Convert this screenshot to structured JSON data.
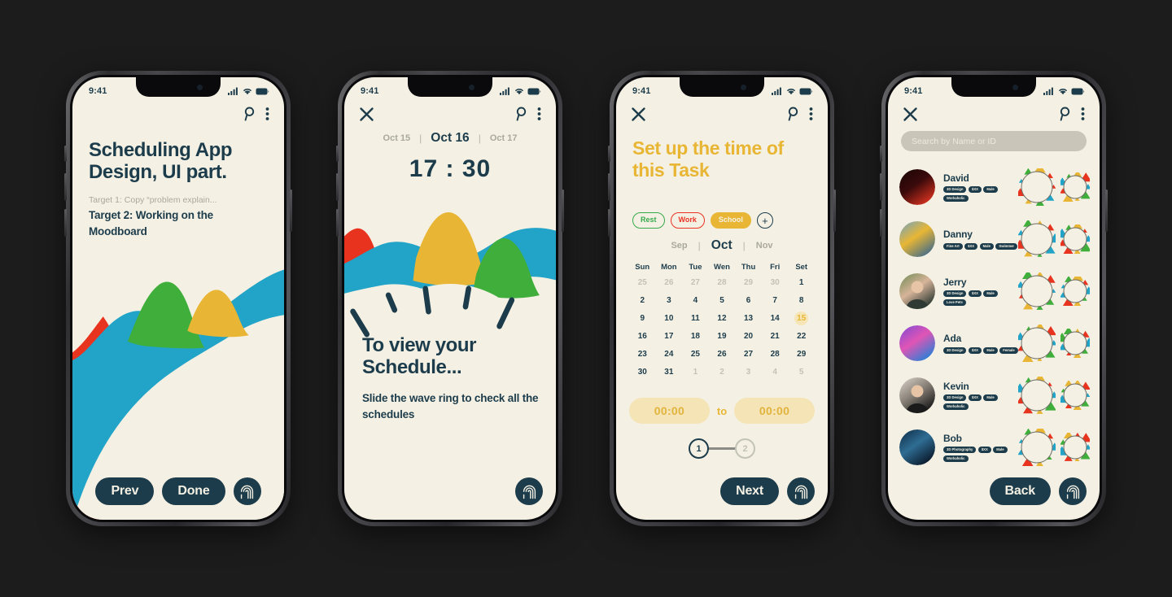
{
  "meta": {
    "background": "#1c1c1c",
    "screen_bg": "#f4f1e4",
    "ink": "#1d3c4b",
    "accent_yellow": "#e8b634",
    "accent_green": "#36a94b",
    "accent_red": "#ea3323",
    "accent_blue": "#22a3c8",
    "muted": "#a9a99c"
  },
  "status_bar": {
    "time": "9:41",
    "icons": [
      "cellular-signal-icon",
      "wifi-icon",
      "battery-icon"
    ]
  },
  "common": {
    "search_icon": "search-icon",
    "menu_icon": "more-vertical-icon",
    "close_icon": "close-icon",
    "fingerprint_icon": "fingerprint-icon"
  },
  "screen1": {
    "name": "intro-screen",
    "headline": "Scheduling App Design, UI part.",
    "target_done": "Target 1: Copy “problem explain...",
    "target_active": "Target 2: Working on the Moodboard",
    "buttons": {
      "prev": "Prev",
      "done": "Done"
    }
  },
  "screen2": {
    "name": "schedule-clock-screen",
    "dates": [
      {
        "label": "Oct 15",
        "active": false
      },
      {
        "label": "Oct 16",
        "active": true
      },
      {
        "label": "Oct 17",
        "active": false
      }
    ],
    "separator": "|",
    "clock": "17 : 30",
    "headline": "To view your Schedule...",
    "subtext": "Slide the wave ring to check all the schedules"
  },
  "screen3": {
    "name": "set-task-time-screen",
    "title": "Set up the time of this Task",
    "chips": [
      {
        "label": "Rest",
        "style": "rest"
      },
      {
        "label": "Work",
        "style": "work"
      },
      {
        "label": "School",
        "style": "school"
      }
    ],
    "chip_add": "+",
    "months": [
      {
        "label": "Sep",
        "active": false
      },
      {
        "label": "Oct",
        "active": true
      },
      {
        "label": "Nov",
        "active": false
      }
    ],
    "separator": "|",
    "day_headers": [
      "Sun",
      "Mon",
      "Tue",
      "Wen",
      "Thu",
      "Fri",
      "Set"
    ],
    "weeks": [
      [
        {
          "d": "25",
          "s": "out"
        },
        {
          "d": "26",
          "s": "out"
        },
        {
          "d": "27",
          "s": "out"
        },
        {
          "d": "28",
          "s": "out"
        },
        {
          "d": "29",
          "s": "out"
        },
        {
          "d": "30",
          "s": "out"
        },
        {
          "d": "1",
          "s": "in"
        }
      ],
      [
        {
          "d": "2",
          "s": "in"
        },
        {
          "d": "3",
          "s": "in"
        },
        {
          "d": "4",
          "s": "in"
        },
        {
          "d": "5",
          "s": "in"
        },
        {
          "d": "6",
          "s": "in"
        },
        {
          "d": "7",
          "s": "in"
        },
        {
          "d": "8",
          "s": "in"
        }
      ],
      [
        {
          "d": "9",
          "s": "in"
        },
        {
          "d": "10",
          "s": "in"
        },
        {
          "d": "11",
          "s": "in"
        },
        {
          "d": "12",
          "s": "in"
        },
        {
          "d": "13",
          "s": "in"
        },
        {
          "d": "14",
          "s": "in"
        },
        {
          "d": "15",
          "s": "sel"
        }
      ],
      [
        {
          "d": "16",
          "s": "in"
        },
        {
          "d": "17",
          "s": "in"
        },
        {
          "d": "18",
          "s": "in"
        },
        {
          "d": "19",
          "s": "in"
        },
        {
          "d": "20",
          "s": "in"
        },
        {
          "d": "21",
          "s": "in"
        },
        {
          "d": "22",
          "s": "in"
        }
      ],
      [
        {
          "d": "23",
          "s": "in"
        },
        {
          "d": "24",
          "s": "in"
        },
        {
          "d": "25",
          "s": "in"
        },
        {
          "d": "26",
          "s": "in"
        },
        {
          "d": "27",
          "s": "in"
        },
        {
          "d": "28",
          "s": "in"
        },
        {
          "d": "29",
          "s": "in"
        }
      ],
      [
        {
          "d": "30",
          "s": "in"
        },
        {
          "d": "31",
          "s": "in"
        },
        {
          "d": "1",
          "s": "out"
        },
        {
          "d": "2",
          "s": "out"
        },
        {
          "d": "3",
          "s": "out"
        },
        {
          "d": "4",
          "s": "out"
        },
        {
          "d": "5",
          "s": "out"
        }
      ]
    ],
    "time_from": "00:00",
    "time_to_label": "to",
    "time_until": "00:00",
    "steps": [
      {
        "label": "1",
        "active": true
      },
      {
        "label": "2",
        "active": false
      }
    ],
    "buttons": {
      "next": "Next"
    }
  },
  "screen4": {
    "name": "contacts-screen",
    "search_placeholder": "Search by Name or ID",
    "search_value": "",
    "contacts": [
      {
        "name": "David",
        "tags": [
          "3D Design",
          "$XX",
          "Male",
          "Workaholic"
        ],
        "avatar": "red-typography-art"
      },
      {
        "name": "Danny",
        "tags": [
          "Fine Art",
          "$XX",
          "Male",
          "Swimmer"
        ],
        "avatar": "sunset-sea-painting"
      },
      {
        "name": "Jerry",
        "tags": [
          "3D Design",
          "$XX",
          "Male",
          "Love Pets"
        ],
        "avatar": "smiling-man-photo"
      },
      {
        "name": "Ada",
        "tags": [
          "3D Design",
          "$XX",
          "Male",
          "Female"
        ],
        "avatar": "aurora-gradient"
      },
      {
        "name": "Kevin",
        "tags": [
          "3D Design",
          "$XX",
          "Male",
          "Workaholic"
        ],
        "avatar": "man-black-tshirt-photo"
      },
      {
        "name": "Bob",
        "tags": [
          "3D Photography",
          "$XX",
          "Male",
          "Workaholic"
        ],
        "avatar": "dark-ocean-photo"
      }
    ],
    "buttons": {
      "back": "Back"
    }
  }
}
